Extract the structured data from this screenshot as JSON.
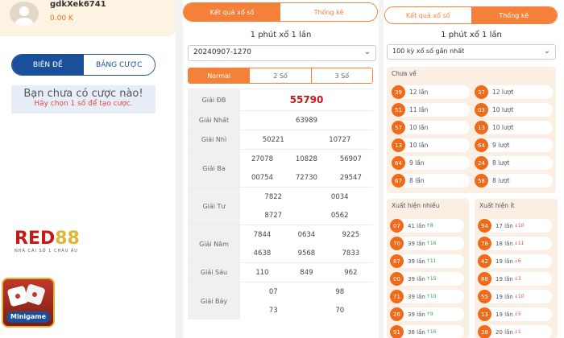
{
  "user": {
    "name": "gdkXek6741",
    "balance": "0.00 K"
  },
  "bet_tabs": {
    "tab1": "BIÊN ĐỀ",
    "tab2": "BẢNG CƯỢC"
  },
  "empty": {
    "title": "Bạn chưa có cược nào!",
    "subtitle": "Hãy chọn 1 số để tạo cược."
  },
  "logo": {
    "word_part1": "RED",
    "word_part2": "88",
    "tagline": "NHÀ CÁI SỐ 1 CHÂU ÂU"
  },
  "minigame": {
    "label": "Minigame"
  },
  "mid": {
    "tab_results": "Kết quả xổ số",
    "tab_stats": "Thống kê",
    "title": "1 phút xổ 1 lần",
    "draw_id": "20240907-1270",
    "modes": [
      "Normal",
      "2 Số",
      "3 Số"
    ],
    "prizes": [
      {
        "label": "Giải ĐB",
        "values": [
          "55790"
        ]
      },
      {
        "label": "Giải Nhất",
        "values": [
          "63989"
        ]
      },
      {
        "label": "Giải Nhì",
        "values": [
          "50221",
          "10727"
        ]
      },
      {
        "label": "Giải Ba",
        "values": [
          "27078",
          "10828",
          "56907",
          "00754",
          "72730",
          "29547"
        ]
      },
      {
        "label": "Giải Tư",
        "values": [
          "7822",
          "0034",
          "8727",
          "0562"
        ]
      },
      {
        "label": "Giải Năm",
        "values": [
          "7844",
          "0634",
          "9225",
          "4638",
          "9568",
          "7833"
        ]
      },
      {
        "label": "Giải Sáu",
        "values": [
          "110",
          "849",
          "962"
        ]
      },
      {
        "label": "Giải Bảy",
        "values": [
          "07",
          "98",
          "73",
          "70"
        ]
      }
    ]
  },
  "right": {
    "tab_results": "Kết quả xổ số",
    "tab_stats": "Thống kê",
    "title": "1 phút xổ 1 lần",
    "history_select": "100 kỳ xổ số gần nhất",
    "chua_ve": {
      "title": "Chưa về",
      "items": [
        {
          "num": "39",
          "text": "12 lần"
        },
        {
          "num": "37",
          "text": "12 lượt"
        },
        {
          "num": "51",
          "text": "11 lần"
        },
        {
          "num": "03",
          "text": "10 lượt"
        },
        {
          "num": "57",
          "text": "10 lần"
        },
        {
          "num": "13",
          "text": "10 lượt"
        },
        {
          "num": "13",
          "text": "10 lần"
        },
        {
          "num": "64",
          "text": "9 lượt"
        },
        {
          "num": "64",
          "text": "9 lần"
        },
        {
          "num": "24",
          "text": "8 lượt"
        },
        {
          "num": "67",
          "text": "8 lần"
        },
        {
          "num": "58",
          "text": "8 lượt"
        }
      ]
    },
    "xh_nhieu": {
      "title": "Xuất hiện nhiều",
      "items": [
        {
          "num": "07",
          "text": "41 lần",
          "delta": "↑8"
        },
        {
          "num": "70",
          "text": "39 lần",
          "delta": "↑16"
        },
        {
          "num": "87",
          "text": "39 lần",
          "delta": "↑11"
        },
        {
          "num": "00",
          "text": "39 lần",
          "delta": "↑15"
        },
        {
          "num": "71",
          "text": "39 lần",
          "delta": "↑10"
        },
        {
          "num": "26",
          "text": "39 lần",
          "delta": "↑9"
        },
        {
          "num": "91",
          "text": "38 lần",
          "delta": "↑16"
        }
      ]
    },
    "xh_it": {
      "title": "Xuất hiện ít",
      "items": [
        {
          "num": "94",
          "text": "17 lần",
          "delta": "↓10"
        },
        {
          "num": "78",
          "text": "18 lần",
          "delta": "↓11"
        },
        {
          "num": "42",
          "text": "19 lần",
          "delta": "↓6"
        },
        {
          "num": "88",
          "text": "19 lần",
          "delta": "↓3"
        },
        {
          "num": "55",
          "text": "19 lần",
          "delta": "↓10"
        },
        {
          "num": "13",
          "text": "19 lần",
          "delta": "↓5"
        },
        {
          "num": "38",
          "text": "20 lần",
          "delta": "↓1"
        }
      ]
    }
  },
  "colors": {
    "accent": "#f4803a",
    "ball": "#f06a1a",
    "primary_blue": "#1a4f9c",
    "jackpot_red": "#c41a1a"
  }
}
